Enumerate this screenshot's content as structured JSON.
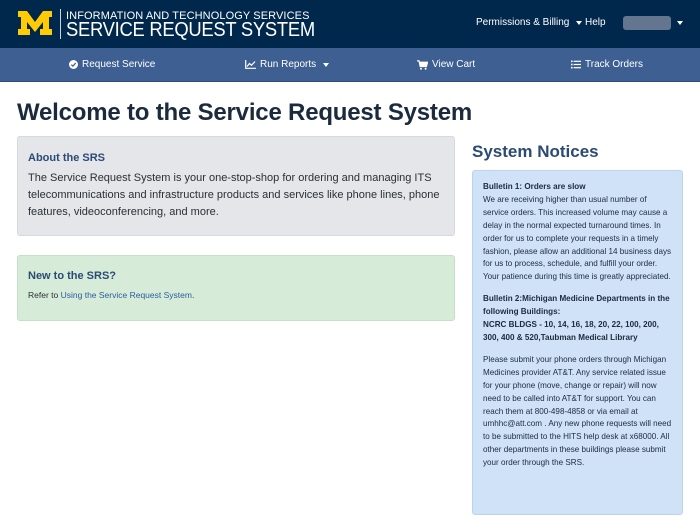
{
  "header": {
    "org_name": "INFORMATION AND TECHNOLOGY SERVICES",
    "system_name": "SERVICE REQUEST SYSTEM",
    "logo_letter": "M",
    "brand_colors": {
      "navy": "#00274c",
      "maize": "#ffcb05"
    },
    "nav": [
      {
        "label": "Permissions & Billing",
        "has_dropdown": true
      },
      {
        "label": "Help",
        "has_dropdown": false
      }
    ],
    "user_menu": {
      "has_dropdown": true
    }
  },
  "subnav": {
    "items": [
      {
        "label": "Request Service",
        "icon": "check-circle-icon"
      },
      {
        "label": "Run Reports",
        "icon": "line-chart-icon",
        "has_dropdown": true
      },
      {
        "label": "View Cart",
        "icon": "cart-icon"
      },
      {
        "label": "Track Orders",
        "icon": "list-icon"
      }
    ]
  },
  "main": {
    "title": "Welcome to the Service Request System",
    "about": {
      "heading": "About the SRS",
      "body": "The Service Request System is your one-stop-shop for ordering and managing ITS telecommunications and infrastructure products and services like phone lines, phone features, videoconferencing, and more."
    },
    "new_user": {
      "heading": "New to the SRS?",
      "prefix": "Refer to ",
      "link": "Using the Service Request System",
      "suffix": "."
    }
  },
  "notices": {
    "title": "System Notices",
    "bulletin1": {
      "heading": "Bulletin 1: Orders are slow",
      "body": "We are receiving higher than usual number of service orders. This increased volume may cause a delay in the normal expected turnaround times. In order for us to complete your requests in a timely fashion, please allow an additional 14 business days for us to process, schedule, and fulfill your order. Your patience during this time is greatly appreciated."
    },
    "bulletin2": {
      "heading": "Bulletin 2:Michigan Medicine Departments in the following Buildings:",
      "subheading": "NCRC BLDGS - 10, 14, 16, 18, 20, 22, 100, 200, 300, 400 & 520,Taubman Medical Library",
      "body": "Please submit your phone orders through Michigan Medicines provider AT&T. Any service related issue for your phone (move, change or repair) will now need to be called into AT&T for support. You can reach them at 800-498-4858 or via email at umhhc@att.com . Any new phone requests will need to be submitted to the HITS help desk at x68000. All other departments in these buildings please submit your order through the SRS."
    }
  }
}
